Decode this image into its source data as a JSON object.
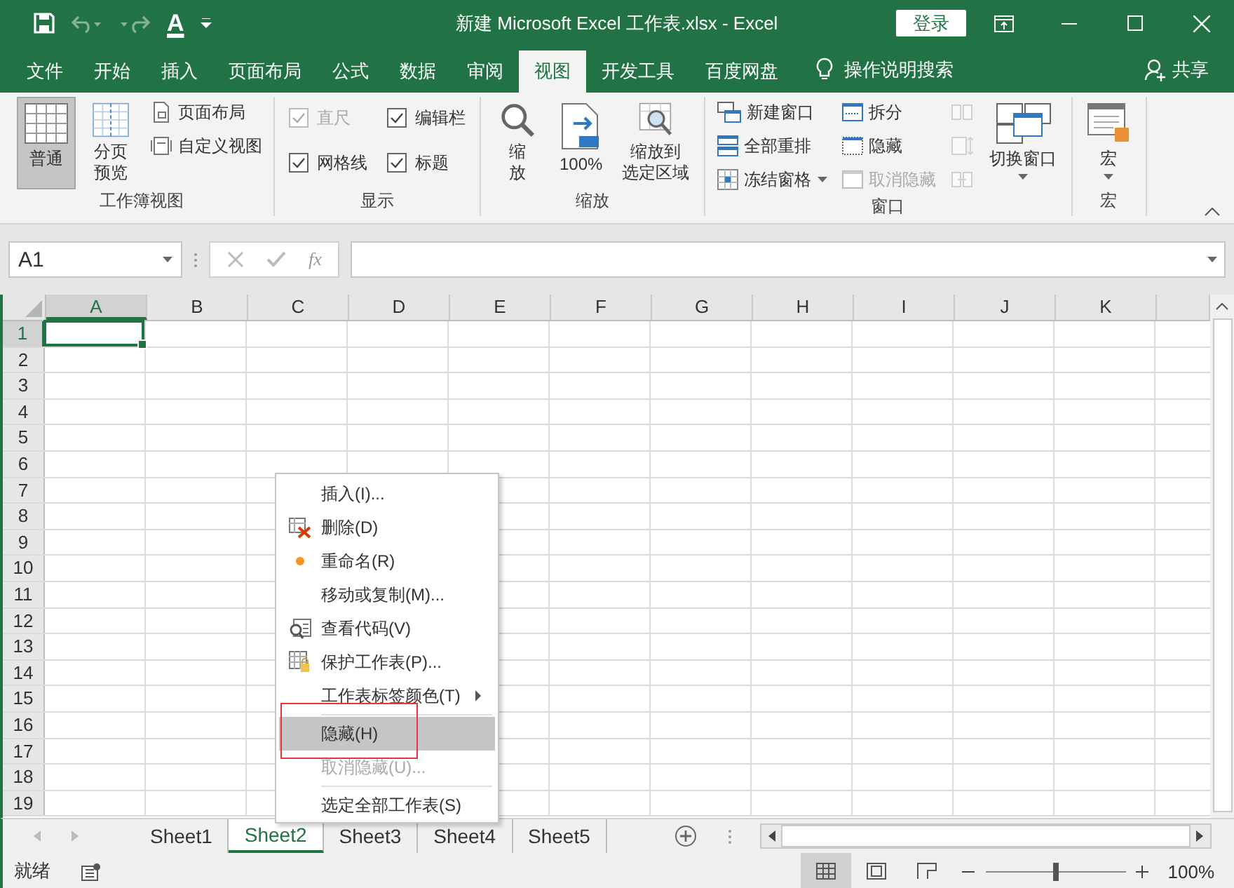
{
  "title_bar": {
    "quick_access": [
      {
        "kind": "save",
        "disabled": false
      },
      {
        "kind": "undo",
        "disabled": true
      },
      {
        "kind": "redo",
        "disabled": true
      },
      {
        "kind": "font-color",
        "label": "A",
        "disabled": false
      },
      {
        "kind": "customize",
        "disabled": false
      }
    ],
    "title": "新建 Microsoft Excel 工作表.xlsx  -  Excel",
    "login": "登录"
  },
  "ribbon_tabs": [
    {
      "label": "文件",
      "selected": false
    },
    {
      "label": "开始",
      "selected": false
    },
    {
      "label": "插入",
      "selected": false
    },
    {
      "label": "页面布局",
      "selected": false
    },
    {
      "label": "公式",
      "selected": false
    },
    {
      "label": "数据",
      "selected": false
    },
    {
      "label": "审阅",
      "selected": false
    },
    {
      "label": "视图",
      "selected": true
    },
    {
      "label": "开发工具",
      "selected": false
    },
    {
      "label": "百度网盘",
      "selected": false
    }
  ],
  "tell_me": "操作说明搜索",
  "share": "共享",
  "ribbon_groups": [
    {
      "label": "工作簿视图",
      "columns": [
        [
          {
            "kind": "large",
            "label": [
              "普通"
            ],
            "selected": true,
            "disabled": false
          }
        ],
        [
          {
            "kind": "large",
            "label": [
              "分页",
              "预览"
            ],
            "selected": false,
            "disabled": false
          }
        ],
        [
          {
            "kind": "small",
            "label": "页面布局",
            "disabled": false
          },
          {
            "kind": "small",
            "label": "自定义视图",
            "disabled": false
          }
        ]
      ]
    },
    {
      "label": "显示",
      "columns": [
        [
          {
            "kind": "check",
            "label": "直尺",
            "checked": true,
            "disabled": true
          },
          {
            "kind": "check",
            "label": "网格线",
            "checked": true,
            "disabled": false
          }
        ],
        [
          {
            "kind": "check",
            "label": "编辑栏",
            "checked": true,
            "disabled": false
          },
          {
            "kind": "check",
            "label": "标题",
            "checked": true,
            "disabled": false
          }
        ]
      ]
    },
    {
      "label": "缩放",
      "columns": [
        [
          {
            "kind": "large",
            "label": [
              "缩",
              "放"
            ],
            "selected": false,
            "disabled": false
          }
        ],
        [
          {
            "kind": "large",
            "label": [
              "100%"
            ],
            "selected": false,
            "disabled": false
          }
        ],
        [
          {
            "kind": "large",
            "label": [
              "缩放到",
              "选定区域"
            ],
            "selected": false,
            "disabled": false
          }
        ]
      ]
    },
    {
      "label": "窗口",
      "columns": [
        [
          {
            "kind": "small",
            "label": "新建窗口",
            "disabled": false
          },
          {
            "kind": "small",
            "label": "全部重排",
            "disabled": false
          },
          {
            "kind": "small",
            "label": "冻结窗格",
            "disabled": false,
            "dropdown": true
          }
        ],
        [
          {
            "kind": "small",
            "label": "拆分",
            "disabled": false
          },
          {
            "kind": "small",
            "label": "隐藏",
            "disabled": false
          },
          {
            "kind": "small",
            "label": "取消隐藏",
            "disabled": true
          }
        ],
        [
          {
            "kind": "icon",
            "disabled": true
          },
          {
            "kind": "icon",
            "disabled": true
          },
          {
            "kind": "icon",
            "disabled": true
          }
        ],
        [
          {
            "kind": "large",
            "label": [
              "切换窗口"
            ],
            "selected": false,
            "disabled": false,
            "dropdown": true
          }
        ]
      ]
    },
    {
      "label": "宏",
      "columns": [
        [
          {
            "kind": "large",
            "label": [
              "宏"
            ],
            "selected": false,
            "disabled": false,
            "dropdown": true
          }
        ]
      ]
    }
  ],
  "formula_bar": {
    "name_box": "A1",
    "fx": "fx"
  },
  "grid": {
    "columns": [
      {
        "label": "A",
        "selected": true
      },
      {
        "label": "B",
        "selected": false
      },
      {
        "label": "C",
        "selected": false
      },
      {
        "label": "D",
        "selected": false
      },
      {
        "label": "E",
        "selected": false
      },
      {
        "label": "F",
        "selected": false
      },
      {
        "label": "G",
        "selected": false
      },
      {
        "label": "H",
        "selected": false
      },
      {
        "label": "I",
        "selected": false
      },
      {
        "label": "J",
        "selected": false
      },
      {
        "label": "K",
        "selected": false
      }
    ],
    "rows": [
      {
        "label": "1",
        "selected": true
      },
      {
        "label": "2",
        "selected": false
      },
      {
        "label": "3",
        "selected": false
      },
      {
        "label": "4",
        "selected": false
      },
      {
        "label": "5",
        "selected": false
      },
      {
        "label": "6",
        "selected": false
      },
      {
        "label": "7",
        "selected": false
      },
      {
        "label": "8",
        "selected": false
      },
      {
        "label": "9",
        "selected": false
      },
      {
        "label": "10",
        "selected": false
      },
      {
        "label": "11",
        "selected": false
      },
      {
        "label": "12",
        "selected": false
      },
      {
        "label": "13",
        "selected": false
      },
      {
        "label": "14",
        "selected": false
      },
      {
        "label": "15",
        "selected": false
      },
      {
        "label": "16",
        "selected": false
      },
      {
        "label": "17",
        "selected": false
      },
      {
        "label": "18",
        "selected": false
      },
      {
        "label": "19",
        "selected": false
      }
    ]
  },
  "sheet_tabs": [
    {
      "label": "Sheet1",
      "selected": false
    },
    {
      "label": "Sheet2",
      "selected": true
    },
    {
      "label": "Sheet3",
      "selected": false
    },
    {
      "label": "Sheet4",
      "selected": false
    },
    {
      "label": "Sheet5",
      "selected": false
    }
  ],
  "context_menu": [
    {
      "kind": "command",
      "label": "插入(I)...",
      "disabled": false,
      "selected": false,
      "marked": false
    },
    {
      "kind": "command",
      "label": "删除(D)",
      "disabled": false,
      "selected": false,
      "marked": false
    },
    {
      "kind": "command",
      "label": "重命名(R)",
      "disabled": false,
      "selected": false,
      "marked": false
    },
    {
      "kind": "command",
      "label": "移动或复制(M)...",
      "disabled": false,
      "selected": false,
      "marked": false
    },
    {
      "kind": "command",
      "label": "查看代码(V)",
      "disabled": false,
      "selected": false,
      "marked": false
    },
    {
      "kind": "command",
      "label": "保护工作表(P)...",
      "disabled": false,
      "selected": false,
      "marked": false
    },
    {
      "kind": "submenu",
      "label": "工作表标签颜色(T)",
      "disabled": false,
      "selected": false,
      "marked": false
    },
    {
      "kind": "separator"
    },
    {
      "kind": "command",
      "label": "隐藏(H)",
      "disabled": false,
      "selected": true,
      "marked": true
    },
    {
      "kind": "command",
      "label": "取消隐藏(U)...",
      "disabled": true,
      "selected": false,
      "marked": false
    },
    {
      "kind": "separator"
    },
    {
      "kind": "command",
      "label": "选定全部工作表(S)",
      "disabled": false,
      "selected": false,
      "marked": false
    }
  ],
  "status_bar": {
    "status": "就绪",
    "views": [
      {
        "kind": "normal",
        "selected": true
      },
      {
        "kind": "layout",
        "selected": false
      },
      {
        "kind": "pagebreak",
        "selected": false
      }
    ],
    "zoom_level": {
      "level": 0.5
    },
    "zoom": "100%"
  }
}
